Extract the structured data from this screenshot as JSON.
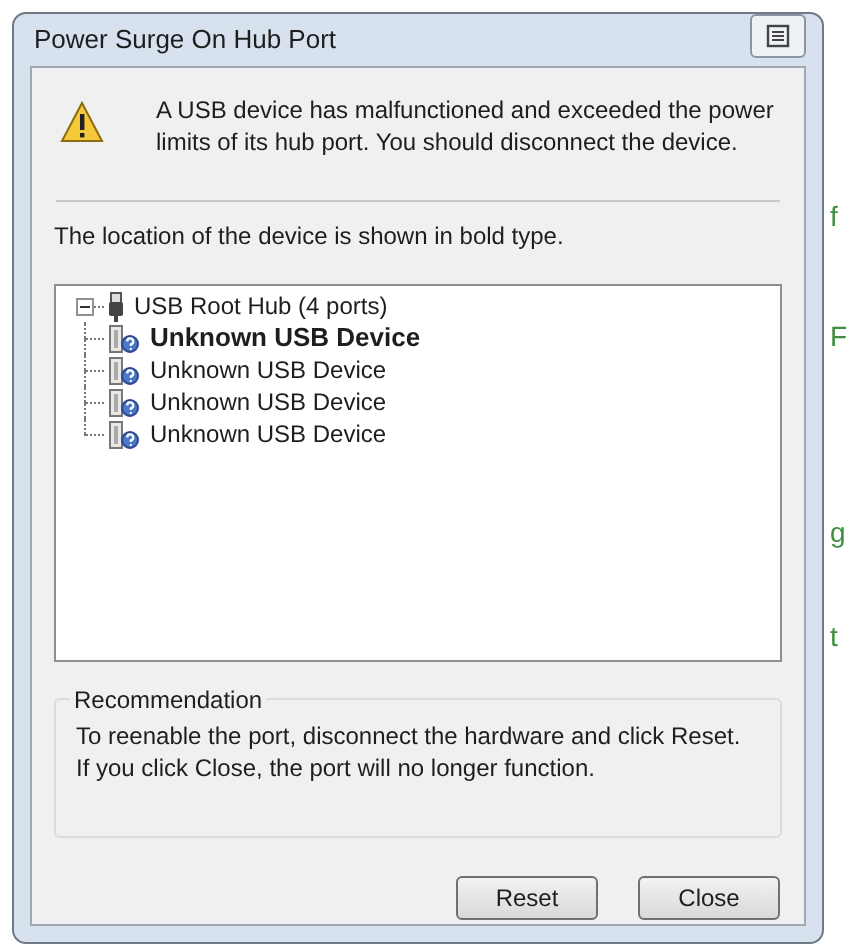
{
  "window": {
    "title": "Power Surge On Hub Port"
  },
  "message": "A USB device has malfunctioned and exceeded the power limits of its hub port. You should disconnect the device.",
  "location_note": "The location of the device is shown in bold type.",
  "tree": [
    {
      "label": "USB Root Hub (4 ports)",
      "kind": "hub",
      "expanded": true,
      "children": [
        {
          "label": "Unknown USB Device",
          "kind": "device",
          "highlighted": true
        },
        {
          "label": "Unknown USB Device",
          "kind": "device",
          "highlighted": false
        },
        {
          "label": "Unknown USB Device",
          "kind": "device",
          "highlighted": false
        },
        {
          "label": "Unknown USB Device",
          "kind": "device",
          "highlighted": false
        }
      ]
    }
  ],
  "recommendation": {
    "title": "Recommendation",
    "text": "To reenable the port, disconnect the hardware and click Reset. If you click Close, the port will no longer function."
  },
  "buttons": [
    "Reset",
    "Close"
  ],
  "background_fragments": [
    "f",
    "F",
    "g",
    "t"
  ]
}
